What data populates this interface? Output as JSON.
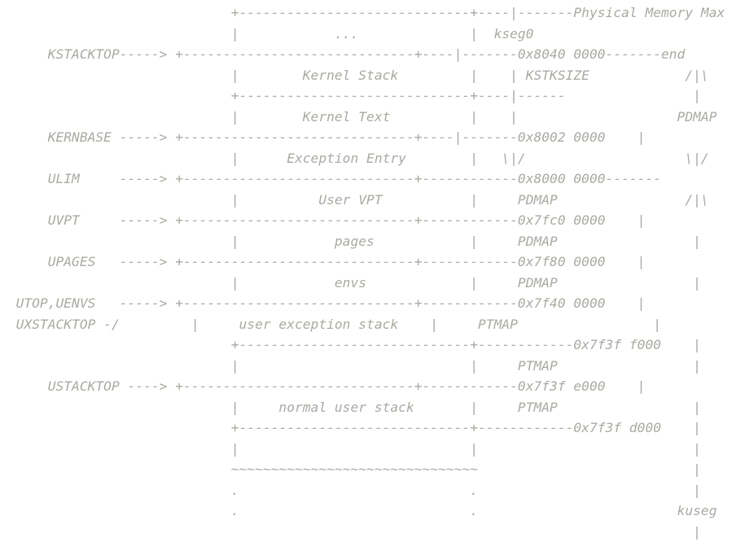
{
  "diagram": {
    "lines": [
      "                             +-----------------------------+----|-------Physical Memory Max",
      "                             |            ...              |  kseg0",
      "      KSTACKTOP-----> +-----------------------------+----|-------0x8040 0000-------end",
      "                             |        Kernel Stack         |    | KSTKSIZE            /|\\",
      "                             +-----------------------------+----|------                |",
      "                             |        Kernel Text          |    |                    PDMAP",
      "      KERNBASE -----> +-----------------------------+----|-------0x8002 0000    |",
      "                             |      Exception Entry        |   \\|/                    \\|/",
      "      ULIM     -----> +-----------------------------+------------0x8000 0000-------",
      "                             |          User VPT           |     PDMAP                /|\\",
      "      UVPT     -----> +-----------------------------+------------0x7fc0 0000    |",
      "                             |            pages            |     PDMAP                 |",
      "      UPAGES   -----> +-----------------------------+------------0x7f80 0000    |",
      "                             |            envs             |     PDMAP                 |",
      "  UTOP,UENVS   -----> +-----------------------------+------------0x7f40 0000    |",
      "  UXSTACKTOP -/         |     user exception stack    |     PTMAP                 |",
      "                             +-----------------------------+------------0x7f3f f000    |",
      "                             |                             |     PTMAP                 |",
      "      USTACKTOP ----> +-----------------------------+------------0x7f3f e000    |",
      "                             |     normal user stack       |     PTMAP                 |",
      "                             +-----------------------------+------------0x7f3f d000    |",
      "                             |                             |                           |",
      "                             ~~~~~~~~~~~~~~~~~~~~~~~~~~~~~~~                           |",
      "                             .                             .                           |",
      "                             .                             .                         kuseg",
      "                                                                                       |"
    ]
  }
}
